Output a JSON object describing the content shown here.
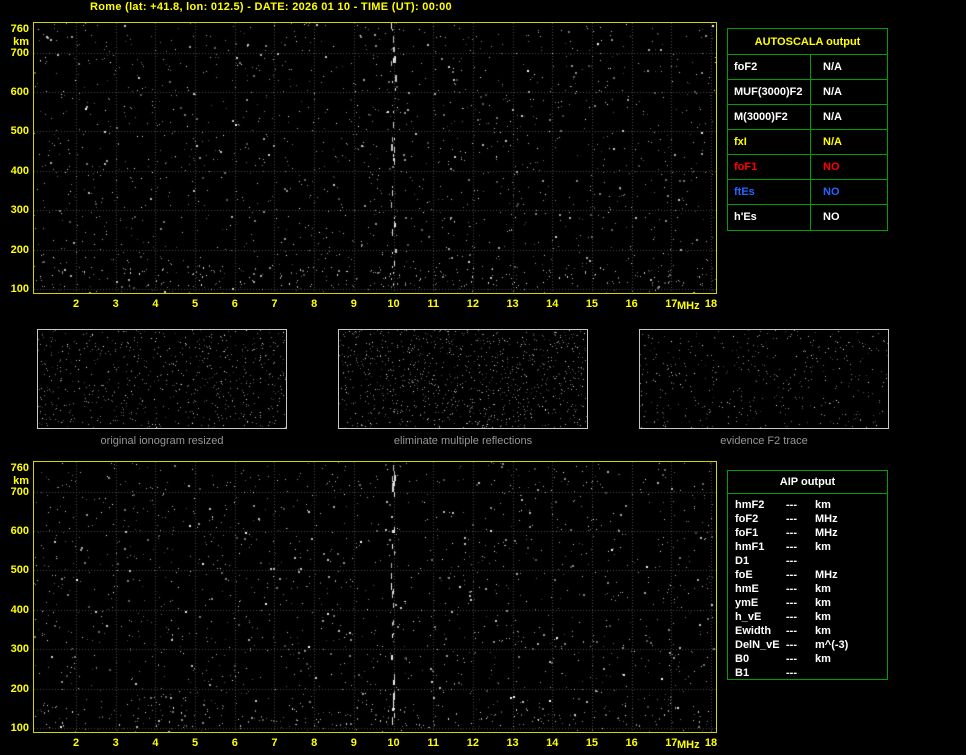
{
  "title": "Rome (lat: +41.8, lon: 012.5) - DATE: 2026 01 10 - TIME (UT): 00:00",
  "colors": {
    "background": "#000000",
    "title": "#ffff00",
    "axis_label": "#ffff00",
    "plot_border": "#d4d400",
    "grid": "#4a4a4a",
    "table_border": "#00a000",
    "caption": "#969696",
    "white": "#ffffff",
    "red": "#ff0000",
    "blue": "#2266ff",
    "yellow": "#ffff00",
    "panel_border": "#c8c8c8"
  },
  "ionogram_top": {
    "x_ticks": [
      2,
      3,
      4,
      5,
      6,
      7,
      8,
      9,
      10,
      11,
      12,
      13,
      14,
      15,
      16,
      17,
      18
    ],
    "x_unit": "MHz",
    "y_ticks": [
      760,
      700,
      600,
      500,
      400,
      300,
      200,
      100
    ],
    "y_unit": "km",
    "x_range": [
      2,
      18
    ],
    "y_range": [
      100,
      760
    ],
    "noise_seed": 20260110,
    "noise_count": 1600,
    "streak_freq_mhz": 10
  },
  "ionogram_bottom": {
    "x_ticks": [
      2,
      3,
      4,
      5,
      6,
      7,
      8,
      9,
      10,
      11,
      12,
      13,
      14,
      15,
      16,
      17,
      18
    ],
    "x_unit": "MHz",
    "y_ticks": [
      760,
      700,
      600,
      500,
      400,
      300,
      200,
      100
    ],
    "y_unit": "km",
    "x_range": [
      2,
      18
    ],
    "y_range": [
      100,
      760
    ],
    "noise_seed": 77103355,
    "noise_count": 1600,
    "streak_freq_mhz": 10
  },
  "processing_panels": [
    {
      "caption": "original ionogram resized",
      "noise_seed": 1011,
      "noise_count": 700
    },
    {
      "caption": "eliminate multiple reflections",
      "noise_seed": 2022,
      "noise_count": 1000
    },
    {
      "caption": "evidence F2 trace",
      "noise_seed": 3033,
      "noise_count": 450
    }
  ],
  "autoscala_table": {
    "title": "AUTOSCALA output",
    "rows": [
      {
        "label": "foF2",
        "value": "N/A",
        "color": "#ffffff"
      },
      {
        "label": "MUF(3000)F2",
        "value": "N/A",
        "color": "#ffffff"
      },
      {
        "label": "M(3000)F2",
        "value": "N/A",
        "color": "#ffffff"
      },
      {
        "label": "fxI",
        "value": "N/A",
        "color": "#ffff00"
      },
      {
        "label": "foF1",
        "value": "NO",
        "color": "#ff0000"
      },
      {
        "label": "ftEs",
        "value": "NO",
        "color": "#2266ff"
      },
      {
        "label": "h'Es",
        "value": "NO",
        "color": "#ffffff"
      }
    ]
  },
  "aip_table": {
    "title": "AIP output",
    "rows": [
      {
        "label": "hmF2",
        "value": "---",
        "unit": "km"
      },
      {
        "label": "foF2",
        "value": "---",
        "unit": "MHz"
      },
      {
        "label": "foF1",
        "value": "---",
        "unit": "MHz"
      },
      {
        "label": "hmF1",
        "value": "---",
        "unit": "km"
      },
      {
        "label": "D1",
        "value": "---",
        "unit": ""
      },
      {
        "label": "foE",
        "value": "---",
        "unit": "MHz"
      },
      {
        "label": "hmE",
        "value": "---",
        "unit": "km"
      },
      {
        "label": "ymE",
        "value": "---",
        "unit": "km"
      },
      {
        "label": "h_vE",
        "value": "---",
        "unit": "km"
      },
      {
        "label": "Ewidth",
        "value": "---",
        "unit": "km"
      },
      {
        "label": "DelN_vE",
        "value": "---",
        "unit": "m^(-3)"
      },
      {
        "label": "B0",
        "value": "---",
        "unit": "km"
      },
      {
        "label": "B1",
        "value": "---",
        "unit": ""
      }
    ]
  }
}
